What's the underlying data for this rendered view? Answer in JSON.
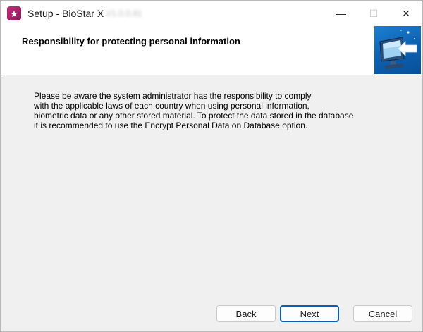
{
  "window": {
    "title": "Setup - BioStar X",
    "version_blurred": "V1.0.0.91",
    "minimize_glyph": "—",
    "maximize_glyph": "☐",
    "close_glyph": "✕"
  },
  "header": {
    "title": "Responsibility for protecting personal information",
    "image_icon": "monitor-with-arrow-icon"
  },
  "body": {
    "message": "Please be aware the system administrator has the responsibility to comply\nwith the applicable laws of each country when using personal information,\nbiometric data or any other stored material. To protect the data stored in the database\n it is recommended to use the Encrypt Personal Data on Database option."
  },
  "buttons": {
    "back": "Back",
    "next": "Next",
    "cancel": "Cancel"
  },
  "colors": {
    "accent": "#0a5fb4",
    "app_icon": "#c2307a"
  }
}
